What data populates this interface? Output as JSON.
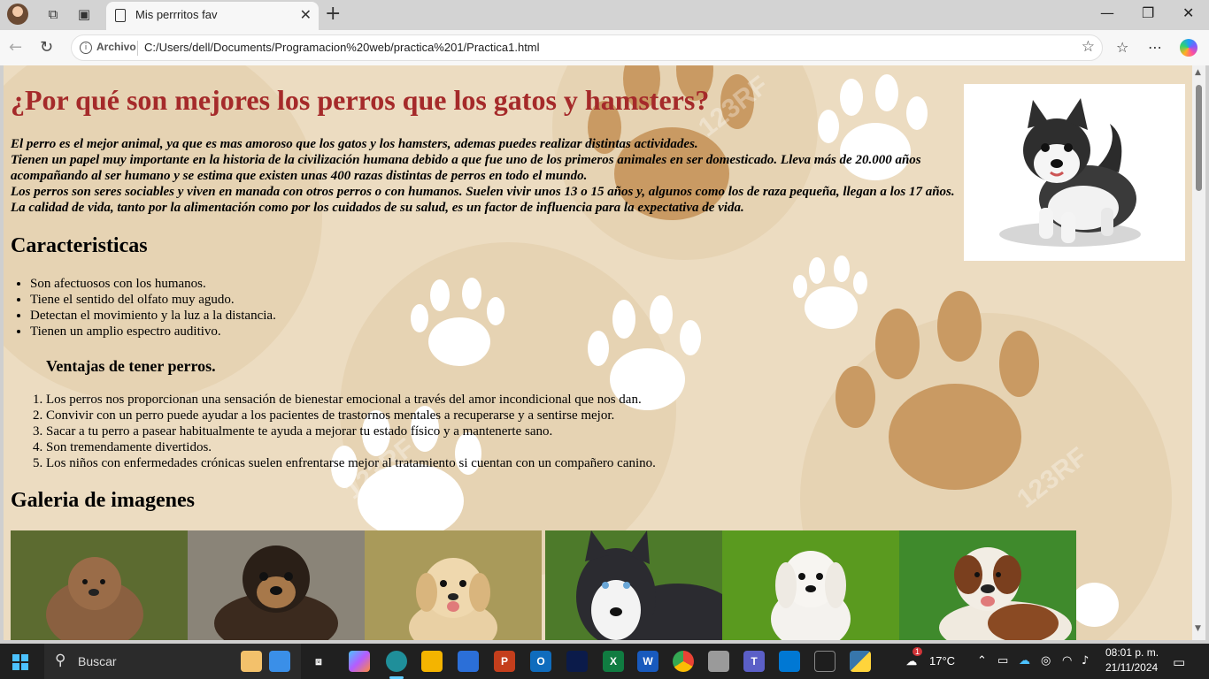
{
  "browser": {
    "tab_title": "Mis perrritos fav",
    "omnibox_badge": "Archivo",
    "url": "C:/Users/dell/Documents/Programacion%20web/practica%201/Practica1.html"
  },
  "page": {
    "title": "¿Por qué son mejores los perros que los gatos y hamsters?",
    "intro_lines": [
      "El perro es el mejor animal, ya que es mas amoroso que los gatos y los hamsters, ademas puedes realizar distintas actividades.",
      "Tienen un papel muy importante en la historia de la civilización humana debido a que fue uno de los primeros animales en ser domesticado. Lleva más de 20.000 años acompañando al ser humano y se estima que existen unas 400 razas distintas de perros en todo el mundo.",
      "Los perros son seres sociables y viven en manada con otros perros o con humanos. Suelen vivir unos 13 o 15 años y, algunos como los de raza pequeña, llegan a los 17 años. La calidad de vida, tanto por la alimentación como por los cuidados de su salud, es un factor de influencia para la expectativa de vida."
    ],
    "features_heading": "Caracteristicas",
    "features": [
      "Son afectuosos con los humanos.",
      "Tiene el sentido del olfato muy agudo.",
      "Detectan el movimiento y la luz a la distancia.",
      "Tienen un amplio espectro auditivo."
    ],
    "advantages_heading": "Ventajas de tener perros.",
    "advantages": [
      "Los perros nos proporcionan una sensación de bienestar emocional a través del amor incondicional que nos dan.",
      "Convivir con un perro puede ayudar a los pacientes de trastornos mentales a recuperarse y a sentirse mejor.",
      "Sacar a tu perro a pasear habitualmente te ayuda a mejorar tu estado físico y a mantenerte sano.",
      "Son tremendamente divertidos.",
      "Los niños con enfermedades crónicas suelen enfrentarse mejor al tratamiento si cuentan con un compañero canino."
    ],
    "gallery_heading": "Galeria de imagenes",
    "gallery": [
      {
        "name": "brown-puppy-image",
        "bg": "#5c6b30",
        "dog": "#8a6040"
      },
      {
        "name": "yorkie-puppy-image",
        "bg": "#8a8478",
        "dog": "#3b2a1e"
      },
      {
        "name": "golden-puppy-image",
        "bg": "#a99a5a",
        "dog": "#e9d0a4"
      },
      {
        "name": "husky-image",
        "bg": "#4d7a2a",
        "dog": "#2b2b30"
      },
      {
        "name": "maltese-image",
        "bg": "#5a9a1f",
        "dog": "#f4f2ee"
      },
      {
        "name": "saint-bernard-image",
        "bg": "#3f8a2c",
        "dog": "#f0eadf"
      }
    ],
    "watermark": "123RF",
    "colors": {
      "title": "#a52a2a",
      "background": "#ecdcc1",
      "paw_brown": "#c99a63",
      "paw_white": "#ffffff"
    }
  },
  "taskbar": {
    "search_placeholder": "Buscar",
    "weather_temp": "17°C",
    "time": "08:01 p. m.",
    "date": "21/11/2024",
    "weather_badge": "1"
  }
}
